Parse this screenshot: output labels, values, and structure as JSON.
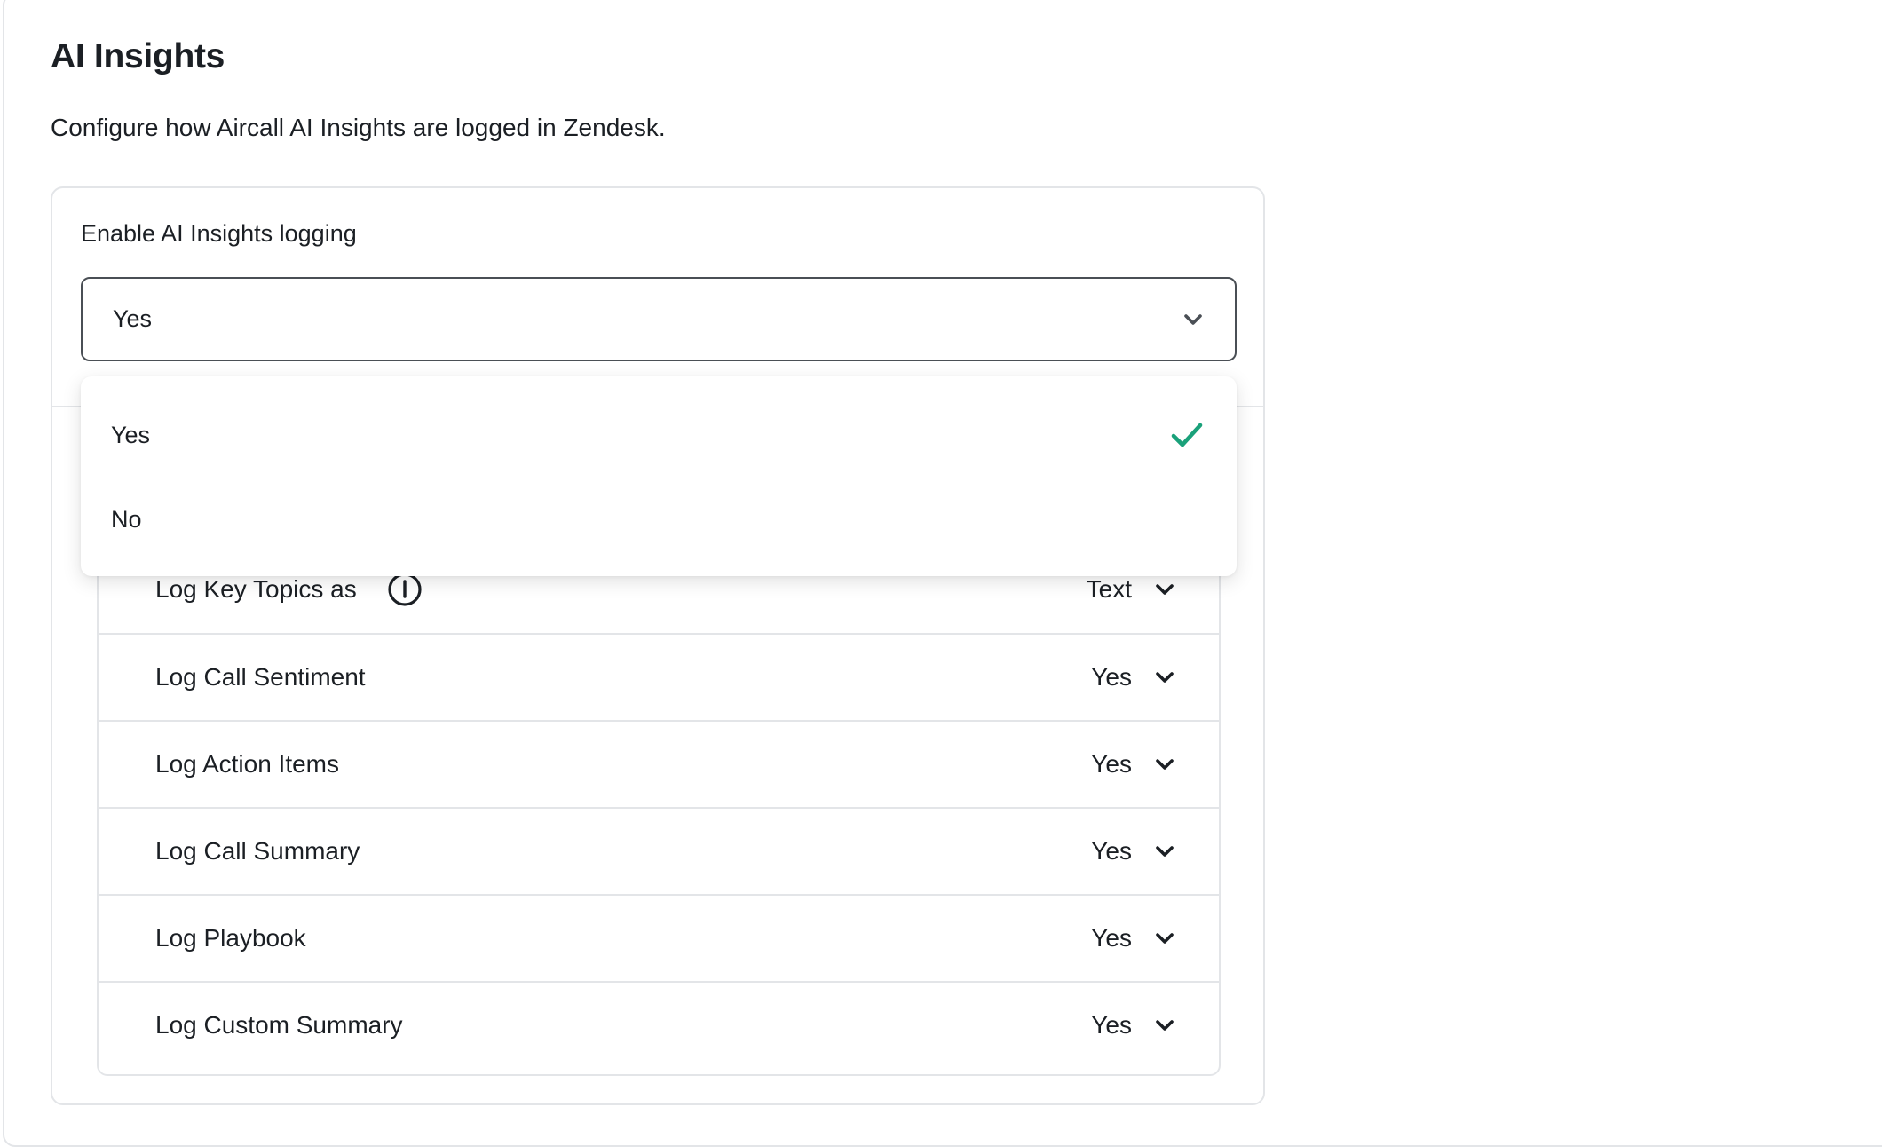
{
  "page": {
    "title": "AI Insights",
    "description": "Configure how Aircall AI Insights are logged in Zendesk."
  },
  "enable_field": {
    "label": "Enable AI Insights logging",
    "value": "Yes",
    "options": [
      {
        "label": "Yes",
        "selected": true
      },
      {
        "label": "No",
        "selected": false
      }
    ]
  },
  "settings": [
    {
      "label": "Log Key Topics as",
      "value": "Text",
      "has_info": true
    },
    {
      "label": "Log Call Sentiment",
      "value": "Yes"
    },
    {
      "label": "Log Action Items",
      "value": "Yes"
    },
    {
      "label": "Log Call Summary",
      "value": "Yes"
    },
    {
      "label": "Log Playbook",
      "value": "Yes"
    },
    {
      "label": "Log Custom Summary",
      "value": "Yes"
    }
  ],
  "colors": {
    "accent_check": "#1aa17a",
    "border": "#e3e5e8",
    "text": "#1b1f24"
  },
  "icons": {
    "dropdown": "chevron-down-icon",
    "selected": "checkmark-icon",
    "info": "info-icon"
  }
}
